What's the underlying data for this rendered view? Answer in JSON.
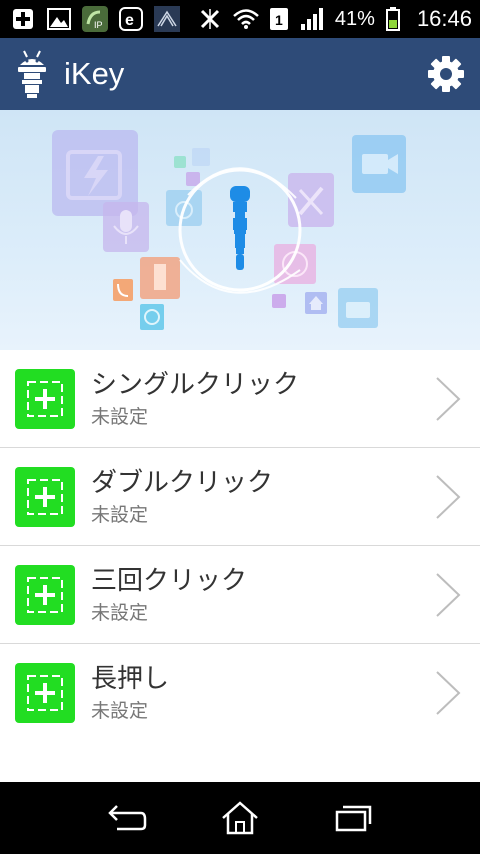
{
  "status_bar": {
    "battery_percent": "41%",
    "time": "16:46",
    "sim_slot": "1",
    "icons": [
      "add-box-icon",
      "image-icon",
      "ip-icon",
      "e-icon",
      "signal-app-icon",
      "no-sim-icon",
      "wifi-icon",
      "sim-icon",
      "signal-icon",
      "battery-icon"
    ]
  },
  "app_bar": {
    "title": "iKey",
    "logo_icon": "ikey-robot-icon",
    "settings_icon": "gear-icon"
  },
  "hero": {
    "center_icon": "ikey-plug-icon"
  },
  "actions": [
    {
      "title": "シングルクリック",
      "status": "未設定"
    },
    {
      "title": "ダブルクリック",
      "status": "未設定"
    },
    {
      "title": "三回クリック",
      "status": "未設定"
    },
    {
      "title": "長押し",
      "status": "未設定"
    }
  ],
  "nav_bar": {
    "back_icon": "back-icon",
    "home_icon": "home-icon",
    "recents_icon": "recents-icon"
  },
  "colors": {
    "app_bar": "#2e4b78",
    "add_button": "#22dd22",
    "plug_blue": "#1e8ce6"
  }
}
